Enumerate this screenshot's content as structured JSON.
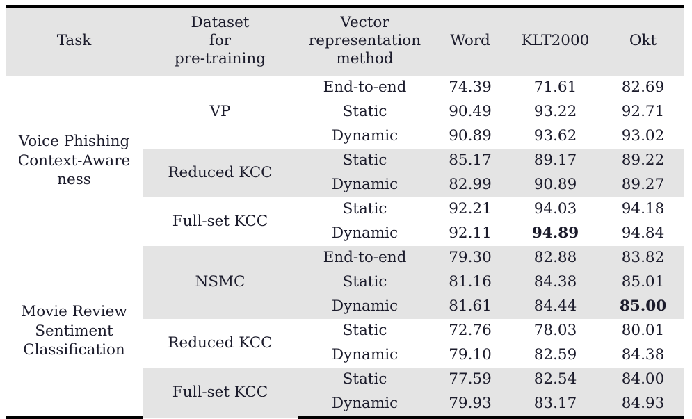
{
  "table": {
    "columns": [
      {
        "key": "task",
        "label_lines": [
          "Task"
        ]
      },
      {
        "key": "dataset",
        "label_lines": [
          "Dataset",
          "for",
          "pre-training"
        ]
      },
      {
        "key": "vector",
        "label_lines": [
          "Vector",
          "representation",
          "method"
        ]
      },
      {
        "key": "word",
        "label_lines": [
          "Word"
        ]
      },
      {
        "key": "klt2000",
        "label_lines": [
          "KLT2000"
        ]
      },
      {
        "key": "okt",
        "label_lines": [
          "Okt"
        ]
      }
    ],
    "header": {
      "task": "Task",
      "dataset_l1": "Dataset",
      "dataset_l2": "for",
      "dataset_l3": "pre-training",
      "vector_l1": "Vector",
      "vector_l2": "representation",
      "vector_l3": "method",
      "word": "Word",
      "klt2000": "KLT2000",
      "okt": "Okt"
    },
    "sections": [
      {
        "task_l1": "Voice Phishing",
        "task_l2": "Context-Aware",
        "task_l3": "ness",
        "groups": [
          {
            "dataset": "VP",
            "shaded": false,
            "rows": [
              {
                "vector": "End-to-end",
                "word": "74.39",
                "klt2000": "71.61",
                "okt": "82.69",
                "bold": []
              },
              {
                "vector": "Static",
                "word": "90.49",
                "klt2000": "93.22",
                "okt": "92.71",
                "bold": []
              },
              {
                "vector": "Dynamic",
                "word": "90.89",
                "klt2000": "93.62",
                "okt": "93.02",
                "bold": []
              }
            ]
          },
          {
            "dataset": "Reduced KCC",
            "shaded": true,
            "rows": [
              {
                "vector": "Static",
                "word": "85.17",
                "klt2000": "89.17",
                "okt": "89.22",
                "bold": []
              },
              {
                "vector": "Dynamic",
                "word": "82.99",
                "klt2000": "90.89",
                "okt": "89.27",
                "bold": []
              }
            ]
          },
          {
            "dataset": "Full-set KCC",
            "shaded": false,
            "rows": [
              {
                "vector": "Static",
                "word": "92.21",
                "klt2000": "94.03",
                "okt": "94.18",
                "bold": []
              },
              {
                "vector": "Dynamic",
                "word": "92.11",
                "klt2000": "94.89",
                "okt": "94.84",
                "bold": [
                  "klt2000"
                ]
              }
            ]
          }
        ]
      },
      {
        "task_l1": "Movie Review",
        "task_l2": "Sentiment",
        "task_l3": "Classification",
        "groups": [
          {
            "dataset": "NSMC",
            "shaded": true,
            "rows": [
              {
                "vector": "End-to-end",
                "word": "79.30",
                "klt2000": "82.88",
                "okt": "83.82",
                "bold": []
              },
              {
                "vector": "Static",
                "word": "81.16",
                "klt2000": "84.38",
                "okt": "85.01",
                "bold": []
              },
              {
                "vector": "Dynamic",
                "word": "81.61",
                "klt2000": "84.44",
                "okt": "85.00",
                "bold": [
                  "okt"
                ]
              }
            ]
          },
          {
            "dataset": "Reduced KCC",
            "shaded": false,
            "rows": [
              {
                "vector": "Static",
                "word": "72.76",
                "klt2000": "78.03",
                "okt": "80.01",
                "bold": []
              },
              {
                "vector": "Dynamic",
                "word": "79.10",
                "klt2000": "82.59",
                "okt": "84.38",
                "bold": []
              }
            ]
          },
          {
            "dataset": "Full-set KCC",
            "shaded": true,
            "rows": [
              {
                "vector": "Static",
                "word": "77.59",
                "klt2000": "82.54",
                "okt": "84.00",
                "bold": []
              },
              {
                "vector": "Dynamic",
                "word": "79.93",
                "klt2000": "83.17",
                "okt": "84.93",
                "bold": []
              }
            ]
          }
        ]
      }
    ],
    "colors": {
      "shade": "#e4e4e4",
      "rule": "#000000",
      "text": "#1b1b2b",
      "background": "#ffffff"
    }
  }
}
